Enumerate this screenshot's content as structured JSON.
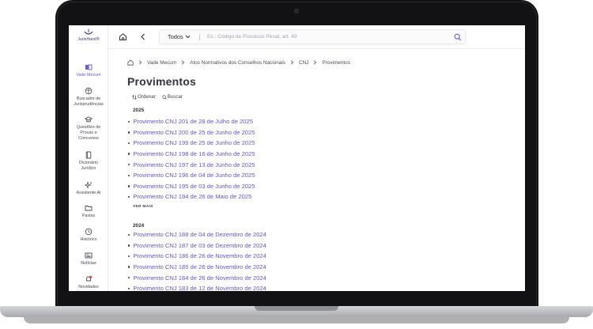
{
  "brand": {
    "name": "JurisHand",
    "suffix": "®"
  },
  "sidebar": {
    "items": [
      {
        "label": "Vade Mecum",
        "active": true
      },
      {
        "label": "Buscador de Jurisprudências"
      },
      {
        "label": "Questões de Provas e Concursos"
      },
      {
        "label": "Dicionário Jurídico"
      },
      {
        "label": "Assistente AI"
      },
      {
        "label": "Pastas"
      },
      {
        "label": "Histórico"
      },
      {
        "label": "Notícias"
      },
      {
        "label": "Novidades"
      }
    ]
  },
  "search": {
    "scope": "Todos",
    "placeholder": "Ex.: Código de Processo Penal, art. 49",
    "value": ""
  },
  "breadcrumb": {
    "items": [
      "Vade Mecum",
      "Atos Normativos dos Conselhos Nacionais",
      "CNJ",
      "Provimentos"
    ]
  },
  "page": {
    "title": "Provimentos",
    "sort_label": "Ordenar",
    "search_label": "Buscar",
    "see_more_label": "VER MAIS"
  },
  "groups": [
    {
      "year": "2025",
      "items": [
        "Provimento CNJ 201 de 28 de Julho de 2025",
        "Provimento CNJ 200 de 25 de Junho de 2025",
        "Provimento CNJ 199 de 25 de Junho de 2025",
        "Provimento CNJ 198 de 16 de Junho de 2025",
        "Provimento CNJ 197 de 13 de Junho de 2025",
        "Provimento CNJ 196 de 04 de Junho de 2025",
        "Provimento CNJ 195 de 03 de Junho de 2025",
        "Provimento CNJ 194 de 26 de Maio de 2025"
      ]
    },
    {
      "year": "2024",
      "items": [
        "Provimento CNJ 188 de 04 de Dezembro de 2024",
        "Provimento CNJ 187 de 03 de Dezembro de 2024",
        "Provimento CNJ 186 de 26 de Novembro de 2024",
        "Provimento CNJ 185 de 26 de Novembro de 2024",
        "Provimento CNJ 184 de 26 de Novembro de 2024",
        "Provimento CNJ 183 de 12 de Novembro de 2024"
      ]
    }
  ],
  "colors": {
    "accent": "#6f56d8",
    "link": "#6a54d6",
    "text": "#33333d",
    "notification": "#e0433b"
  }
}
